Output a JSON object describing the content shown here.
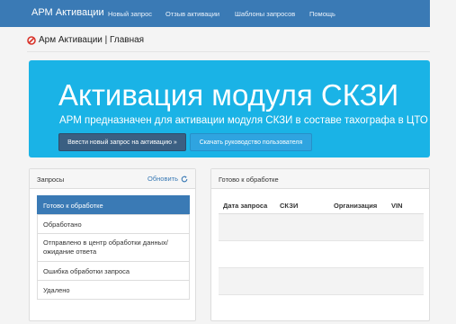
{
  "navbar": {
    "brand": "АРМ Активации",
    "items": [
      "Новый запрос",
      "Отзыв активации",
      "Шаблоны запросов",
      "Помощь"
    ]
  },
  "breadcrumb": "Арм Активации | Главная",
  "hero": {
    "title": "Активация модуля СКЗИ",
    "subtitle": "АРМ предназначен для активации модуля СКЗИ в составе тахографа в ЦТО",
    "primary_button": "Ввести новый запрос на активацию »",
    "secondary_button": "Скачать руководство пользователя"
  },
  "requests_panel": {
    "title": "Запросы",
    "refresh": "Обновить",
    "items": [
      "Готово к обработке",
      "Обработано",
      "Отправлено в центр обработки данных/ожидание ответа",
      "Ошибка обработки запроса",
      "Удалено"
    ],
    "active_index": 0
  },
  "ready_panel": {
    "title": "Готово к обработке",
    "columns": [
      "Дата запроса",
      "СКЗИ",
      "Организация",
      "VIN"
    ]
  },
  "colors": {
    "navbar": "#3a7ab5",
    "hero": "#1ab3e6",
    "active_item": "#3a7ab5"
  }
}
